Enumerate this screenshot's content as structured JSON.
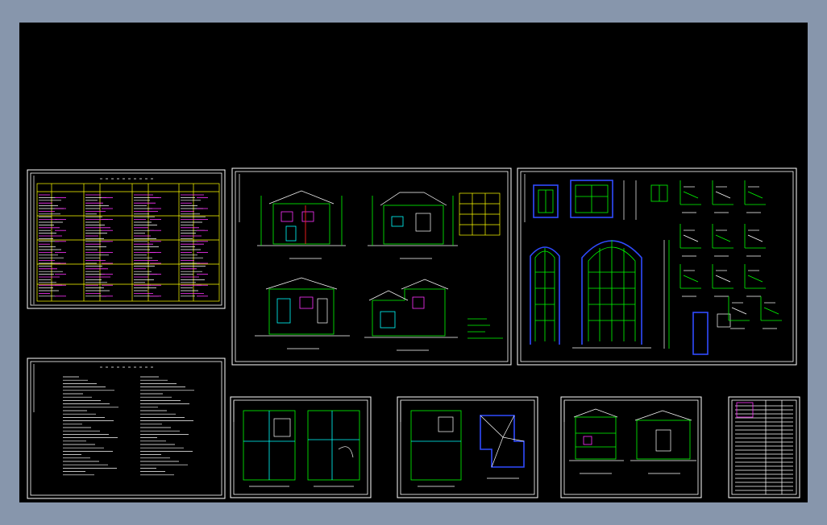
{
  "viewer": {
    "canvas_background": "#000000",
    "window_background": "#8796ac"
  },
  "sheets": [
    {
      "id": "door-window-schedule",
      "kind": "table"
    },
    {
      "id": "elevations",
      "kind": "elevations"
    },
    {
      "id": "window-details",
      "kind": "details"
    },
    {
      "id": "design-notes",
      "kind": "notes"
    },
    {
      "id": "floor-plans-1-2",
      "kind": "plans"
    },
    {
      "id": "floor-plans-3-roof",
      "kind": "plans"
    },
    {
      "id": "sections",
      "kind": "sections"
    },
    {
      "id": "title-block",
      "kind": "index"
    }
  ],
  "colors": {
    "line_green": "#00ff00",
    "line_white": "#ffffff",
    "line_yellow": "#ffff00",
    "line_magenta": "#ff33ff",
    "line_cyan": "#00ffff",
    "line_blue": "#2f4bff",
    "line_red": "#ff2020"
  }
}
